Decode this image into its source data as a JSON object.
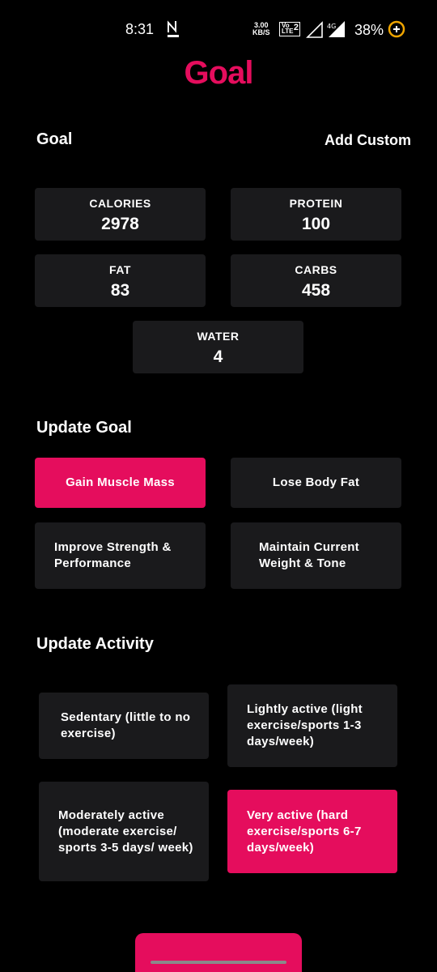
{
  "status": {
    "time": "8:31",
    "speed_value": "3.00",
    "speed_unit": "KB/S",
    "volte": "Vo LTE",
    "sim": "2",
    "network": "4G",
    "battery": "38%"
  },
  "title": "Goal",
  "goal_section": {
    "title": "Goal",
    "add_custom": "Add Custom",
    "cards": [
      {
        "label": "CALORIES",
        "value": "2978"
      },
      {
        "label": "PROTEIN",
        "value": "100"
      },
      {
        "label": "FAT",
        "value": "83"
      },
      {
        "label": "CARBS",
        "value": "458"
      },
      {
        "label": "WATER",
        "value": "4"
      }
    ]
  },
  "update_goal": {
    "title": "Update Goal",
    "options": [
      {
        "label": "Gain Muscle Mass",
        "selected": true
      },
      {
        "label": "Lose Body Fat",
        "selected": false
      },
      {
        "label": "Improve Strength & Performance",
        "selected": false
      },
      {
        "label": "Maintain Current Weight & Tone",
        "selected": false
      }
    ]
  },
  "update_activity": {
    "title": "Update Activity",
    "options": [
      {
        "label": "Sedentary (little to no exercise)",
        "selected": false
      },
      {
        "label": "Lightly active (light exercise/sports 1-3 days/week)",
        "selected": false
      },
      {
        "label": "Moderately active (moderate exercise/ sports 3-5 days/ week)",
        "selected": false
      },
      {
        "label": "Very active (hard exercise/sports 6-7 days/week)",
        "selected": true
      }
    ]
  },
  "colors": {
    "accent": "#e50d5d",
    "card": "#1a1a1c",
    "background": "#000000"
  }
}
